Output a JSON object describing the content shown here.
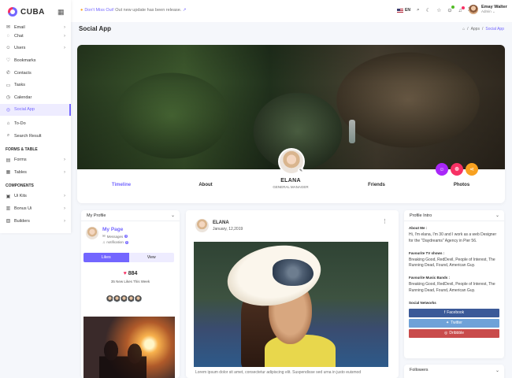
{
  "app": {
    "logo_text": "CUBA"
  },
  "sidebar": {
    "items": [
      {
        "label": "Email",
        "icon": "mail-icon",
        "chevron": true
      },
      {
        "label": "Chat",
        "icon": "chat-icon",
        "chevron": true
      },
      {
        "label": "Users",
        "icon": "users-icon",
        "chevron": true
      },
      {
        "label": "Bookmarks",
        "icon": "heart-icon",
        "chevron": false
      },
      {
        "label": "Contacts",
        "icon": "contacts-icon",
        "chevron": false
      },
      {
        "label": "Tasks",
        "icon": "tasks-icon",
        "chevron": false
      },
      {
        "label": "Calendar",
        "icon": "calendar-icon",
        "chevron": false
      },
      {
        "label": "Social App",
        "icon": "social-icon",
        "chevron": false,
        "active": true
      },
      {
        "label": "To-Do",
        "icon": "todo-icon",
        "chevron": false
      },
      {
        "label": "Search Result",
        "icon": "search-icon",
        "chevron": false
      }
    ],
    "section_forms": "FORMS & TABLE",
    "forms_items": [
      {
        "label": "Forms",
        "icon": "forms-icon"
      },
      {
        "label": "Tables",
        "icon": "tables-icon"
      }
    ],
    "section_components": "COMPONENTS",
    "component_items": [
      {
        "label": "Ui Kits",
        "icon": "uikits-icon"
      },
      {
        "label": "Bonus Ui",
        "icon": "bonus-icon"
      },
      {
        "label": "Builders",
        "icon": "builders-icon"
      }
    ]
  },
  "header": {
    "notice_strong": "Don't Miss Out!",
    "notice_rest": " Out new update has been release.",
    "notice_link": "↗",
    "lang": "EN",
    "user_name": "Emay Walter",
    "user_role": "Admin"
  },
  "page": {
    "title": "Social App",
    "breadcrumb": [
      "Apps",
      "Social App"
    ]
  },
  "cover": {
    "name": "ELANA",
    "role": "GENERAL MANAGER",
    "tabs": [
      "Timeline",
      "About",
      "Friends",
      "Photos"
    ],
    "active_tab": "Timeline",
    "social_colors": [
      "#a927f9",
      "#f73164",
      "#f8a120"
    ]
  },
  "my_profile": {
    "heading": "My Page",
    "card_title": "My Profile",
    "messages_label": "Messages",
    "messages_count": "9",
    "notification_label": "notification",
    "notification_count": "0",
    "likes_label": "Likes",
    "view_label": "View",
    "likes_count": "884",
    "new_likes": "35 New Likes This Week"
  },
  "post": {
    "author": "ELANA",
    "date": "January, 12,2019",
    "text": "Lorem ipsum dolor sit amet, consectetur adipiscing elit. Suspendisse sed urna in justo euismod"
  },
  "intro": {
    "card_title": "Profile Intro",
    "about_heading": "About Me :",
    "about_text": "Hi, I'm elana, I'm 30 and I work as a web Designer for the \"Daydreams\" Agency in Pier 56.",
    "tv_heading": "Favourite TV shows :",
    "tv_text": "Breaking Good, RedDevil, People of Interest, The Running Dead, Found, American Guy.",
    "music_heading": "Favourite Music Bands :",
    "music_text": "Breaking Good, RedDevil, People of Interest, The Running Dead, Found, American Guy.",
    "networks_heading": "Social Networks",
    "facebook": "Facebook",
    "twitter": "Twitter",
    "dribbble": "Dribbble",
    "facebook_color": "#3b5998",
    "twitter_color": "#6fa2d8",
    "dribbble_color": "#c94b4b"
  },
  "followers": {
    "card_title": "Followers"
  },
  "colors": {
    "primary": "#7366ff",
    "secondary": "#f73164",
    "warning": "#f8a120"
  }
}
